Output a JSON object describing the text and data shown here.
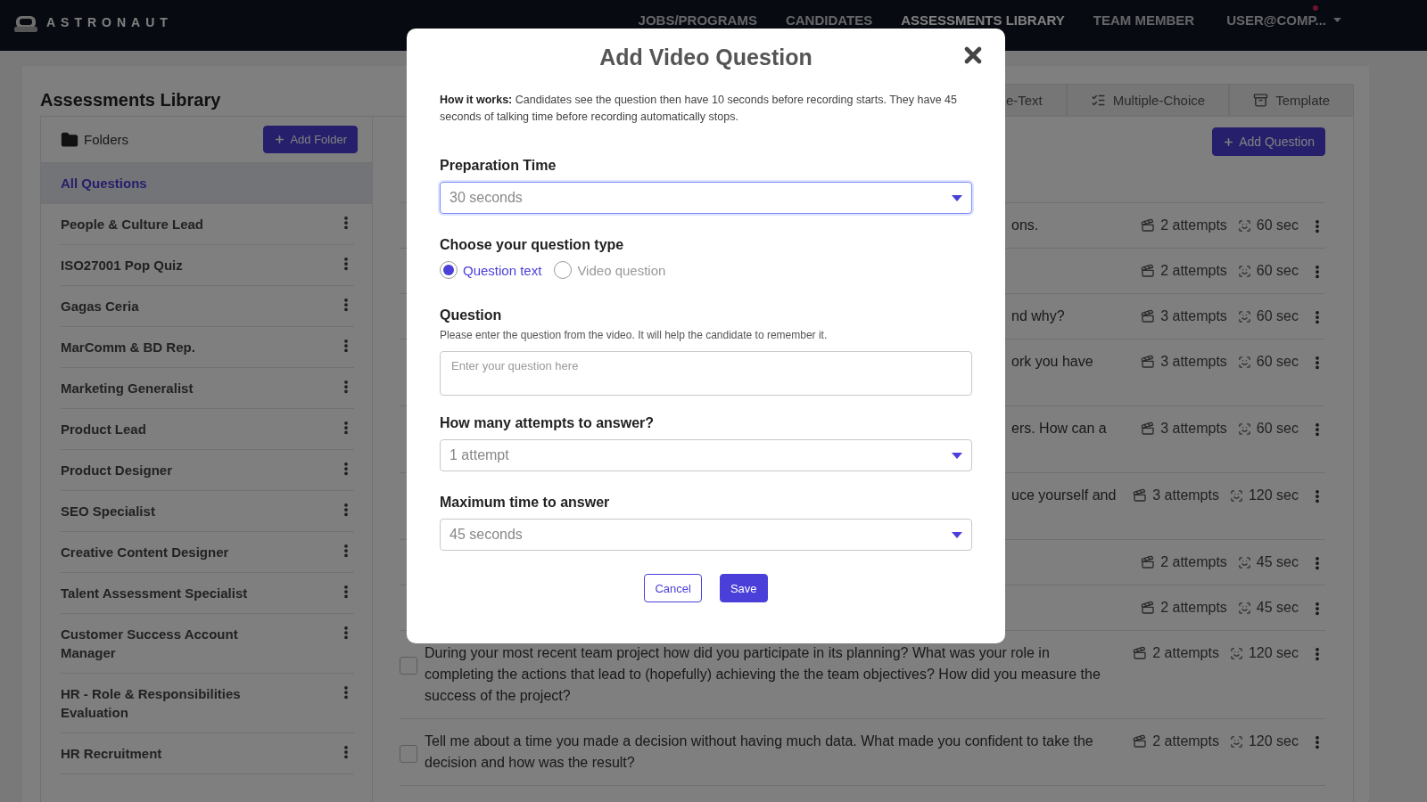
{
  "nav": {
    "logo": "ASTRONAUT",
    "items": [
      {
        "label": "JOBS/PROGRAMS",
        "selected": false
      },
      {
        "label": "CANDIDATES",
        "selected": false
      },
      {
        "label": "ASSESSMENTS LIBRARY",
        "selected": true
      },
      {
        "label": "TEAM MEMBER",
        "selected": false
      }
    ],
    "user": {
      "label": "USER@COMP...",
      "notification": true
    }
  },
  "page_title": "Assessments Library",
  "folders": {
    "title": "Folders",
    "add_button": "Add Folder",
    "items": [
      {
        "label": "All Questions",
        "kind": "all",
        "selected": true
      },
      {
        "label": "People & Culture Lead",
        "kind": "folder",
        "selected": false
      },
      {
        "label": "ISO27001 Pop Quiz",
        "kind": "folder",
        "selected": false
      },
      {
        "label": "Gagas Ceria",
        "kind": "folder",
        "selected": false
      },
      {
        "label": "MarComm & BD Rep.",
        "kind": "folder",
        "selected": false
      },
      {
        "label": "Marketing Generalist",
        "kind": "folder",
        "selected": false
      },
      {
        "label": "Product Lead",
        "kind": "folder",
        "selected": false
      },
      {
        "label": "Product Designer",
        "kind": "folder",
        "selected": false
      },
      {
        "label": "SEO Specialist",
        "kind": "folder",
        "selected": false
      },
      {
        "label": "Creative Content Designer",
        "kind": "folder",
        "selected": false
      },
      {
        "label": "Talent Assessment Specialist",
        "kind": "folder",
        "selected": false
      },
      {
        "label": "Customer Success Account Manager",
        "kind": "folder",
        "selected": false
      },
      {
        "label": "HR - Role & Responsibilities Evaluation",
        "kind": "folder",
        "selected": false
      },
      {
        "label": "HR Recruitment",
        "kind": "folder",
        "selected": false
      }
    ]
  },
  "tabs": [
    {
      "label": "e-Text",
      "kind": "text"
    },
    {
      "label": "Multiple-Choice",
      "kind": "choice"
    },
    {
      "label": "Template",
      "kind": "template"
    }
  ],
  "add_question": "Add Question",
  "questions": [
    {
      "kind": "partial",
      "text": "ons.",
      "attempts": "2 attempts",
      "time": "60 sec"
    },
    {
      "kind": "partial",
      "attempts": "2 attempts",
      "time": "60 sec"
    },
    {
      "kind": "partial",
      "text": "nd why?",
      "attempts": "3 attempts",
      "time": "60 sec"
    },
    {
      "kind": "partial",
      "text": "ork you have",
      "attempts": "3 attempts",
      "time": "60 sec"
    },
    {
      "kind": "partial",
      "text": "ers. How can a",
      "attempts": "3 attempts",
      "time": "60 sec"
    },
    {
      "kind": "partial",
      "text": "uce yourself and",
      "attempts": "3 attempts",
      "time": "120 sec"
    },
    {
      "kind": "partial",
      "attempts": "2 attempts",
      "time": "45 sec"
    },
    {
      "kind": "partial",
      "attempts": "2 attempts",
      "time": "45 sec"
    },
    {
      "kind": "full",
      "checked": false,
      "text": "During your most recent team project how did you participate in its planning? What was your role in completing the actions that lead to (hopefully) achieving the the team objectives? How did you measure the success of the project?",
      "attempts": "2 attempts",
      "time": "120 sec"
    },
    {
      "kind": "full",
      "checked": false,
      "text": "Tell me about a time you made a decision without having much data. What made you confident to take the decision and how was the result?",
      "attempts": "2 attempts",
      "time": "120 sec"
    }
  ],
  "modal": {
    "title": "Add Video Question",
    "info": "**How it works:** Candidates see the question then have 10 seconds before recording starts. They have 45 seconds of talking time before recording automatically stops.",
    "preparation": {
      "label": "Preparation Time",
      "value": "30 seconds",
      "focused": true
    },
    "question_type": {
      "label": "Choose your question type",
      "options": [
        {
          "label": "Question text",
          "selected": true
        },
        {
          "label": "Video question",
          "selected": false
        }
      ]
    },
    "question": {
      "label": "Question",
      "help": "Please enter the question from the video. It will help the candidate to remember it.",
      "placeholder": "Enter your question here"
    },
    "attempts": {
      "label": "How many attempts to answer?",
      "value": "1 attempt",
      "focused": false
    },
    "max_time": {
      "label": "Maximum time to answer",
      "value": "45 seconds",
      "focused": false
    },
    "cancel": "Cancel",
    "save": "Save"
  }
}
